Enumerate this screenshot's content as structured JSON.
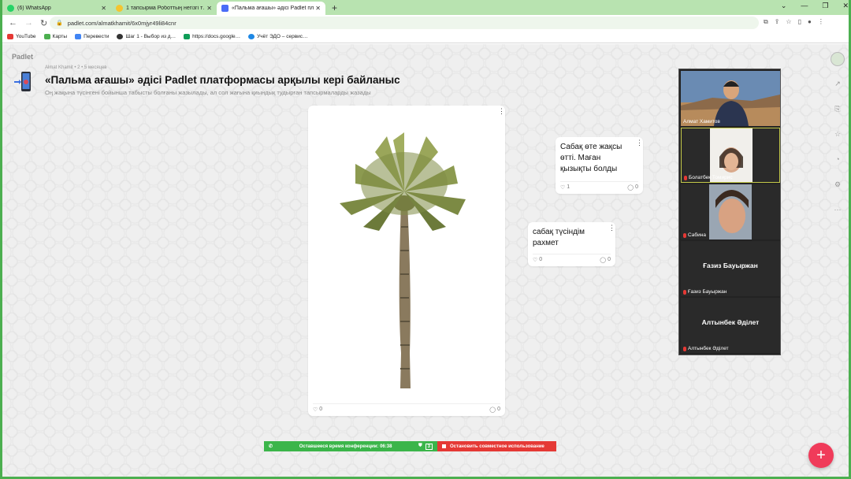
{
  "browser": {
    "tabs": [
      {
        "label": "(6) WhatsApp",
        "icon": "whatsapp-icon",
        "color": "#25d366"
      },
      {
        "label": "1 тапсырма Роботтың негізгі т…",
        "icon": "emoji-icon",
        "color": "#f4c430"
      },
      {
        "label": "«Пальма ағашы» әдісі Padlet пл…",
        "icon": "padlet-icon",
        "color": "#4a6cf7"
      }
    ],
    "url": "padlet.com/almatkhamit/6x0mjyr49li84cnr",
    "bookmarks": [
      {
        "label": "YouTube",
        "color": "#e53935"
      },
      {
        "label": "Карты",
        "color": "#4caf50"
      },
      {
        "label": "Перевести",
        "color": "#4285f4"
      },
      {
        "label": "Шаг 1 - Выбор из д…",
        "color": "#333333"
      },
      {
        "label": "https://docs.google…",
        "color": "#0f9d58"
      },
      {
        "label": "Учёт ЭДО – сервис…",
        "color": "#1e88e5"
      }
    ]
  },
  "board": {
    "logo": "Padlet",
    "author_line": "Almat Khamit • 2 • 5 месяцев",
    "title": "«Пальма ағашы» әдісі Padlet платформасы арқылы кері байланыс",
    "subtitle": "Оң жақына түсінгені бойынша табысты болғаны жазылады, ал сол жағына қиындық тудырған тапсырмаларды жазады"
  },
  "posts": [
    {
      "kind": "image",
      "likes": "0",
      "comments": "0"
    },
    {
      "kind": "text",
      "text": "Сабақ өте жақсы өтті. Маған қызықты болды",
      "likes": "1",
      "comments": "0"
    },
    {
      "kind": "text",
      "text": "сабақ түсіндім рахмет",
      "likes": "0",
      "comments": "0"
    }
  ],
  "video": {
    "participants": [
      {
        "name": "Алмат Хамитов",
        "center": ""
      },
      {
        "name": "Болатбек Томирис",
        "center": ""
      },
      {
        "name": "Сабина",
        "center": ""
      },
      {
        "name": "Ғазиз Бауыржан",
        "center": "Ғазиз Бауыржан"
      },
      {
        "name": "Алтынбек Әділет",
        "center": "Алтынбек Әділет"
      }
    ]
  },
  "conference": {
    "remaining_label": "Оставшееся время конференции: 06:38",
    "count": "3",
    "stop_label": "Остановить совместное использование"
  },
  "colors": {
    "accent_green": "#3bb54a",
    "stop_red": "#e53935",
    "fab_pink": "#f03b5a",
    "chrome_tab_bg": "#b8e3b0"
  }
}
